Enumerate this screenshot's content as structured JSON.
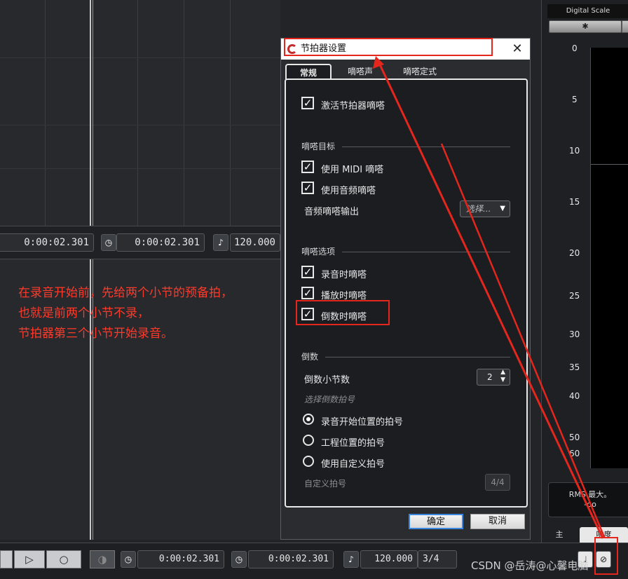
{
  "left_timebar": {
    "time1": "0:00:02.301",
    "time2": "0:00:02.301",
    "tempo": "120.000"
  },
  "annotation": {
    "line1": "在录音开始前，先给两个小节的预备拍，",
    "line2": "也就是前两个小节不录，",
    "line3": "节拍器第三个小节开始录音。"
  },
  "right_panel": {
    "title": "Digital Scale",
    "scale": [
      "0",
      "5",
      "10",
      "15",
      "20",
      "25",
      "30",
      "35",
      "40",
      "50",
      "60"
    ],
    "rms_label": "RMS 最大。",
    "rms_value": "-oo",
    "tab_main": "主",
    "tab_loudness": "响度"
  },
  "dialog": {
    "title": "节拍器设置",
    "close": "✕",
    "tabs": [
      "常规",
      "嘀嗒声",
      "嘀嗒定式"
    ],
    "activate": "激活节拍器嘀嗒",
    "target_section": "嘀嗒目标",
    "use_midi": "使用 MIDI 嘀嗒",
    "use_audio": "使用音频嘀嗒",
    "audio_output_label": "音频嘀嗒输出",
    "audio_output_value": "选择...",
    "options_section": "嘀嗒选项",
    "record_click": "录音时嘀嗒",
    "play_click": "播放时嘀嗒",
    "countin_click": "倒数时嘀嗒",
    "countin_section": "倒数",
    "countin_bars_label": "倒数小节数",
    "countin_bars_value": "2",
    "choose_sig_label": "选择倒数拍号",
    "sig_option1": "录音开始位置的拍号",
    "sig_option2": "工程位置的拍号",
    "sig_option3": "使用自定义拍号",
    "custom_sig_label": "自定义拍号",
    "custom_sig_value": "4/4",
    "ok": "确定",
    "cancel": "取消"
  },
  "transport": {
    "time1": "0:00:02.301",
    "time2": "0:00:02.301",
    "tempo": "120.000",
    "signature": "3/4"
  },
  "watermark": "CSDN @岳涛@心馨电脑",
  "colors": {
    "highlight": "#e4261d",
    "accent": "#3a86e0"
  }
}
